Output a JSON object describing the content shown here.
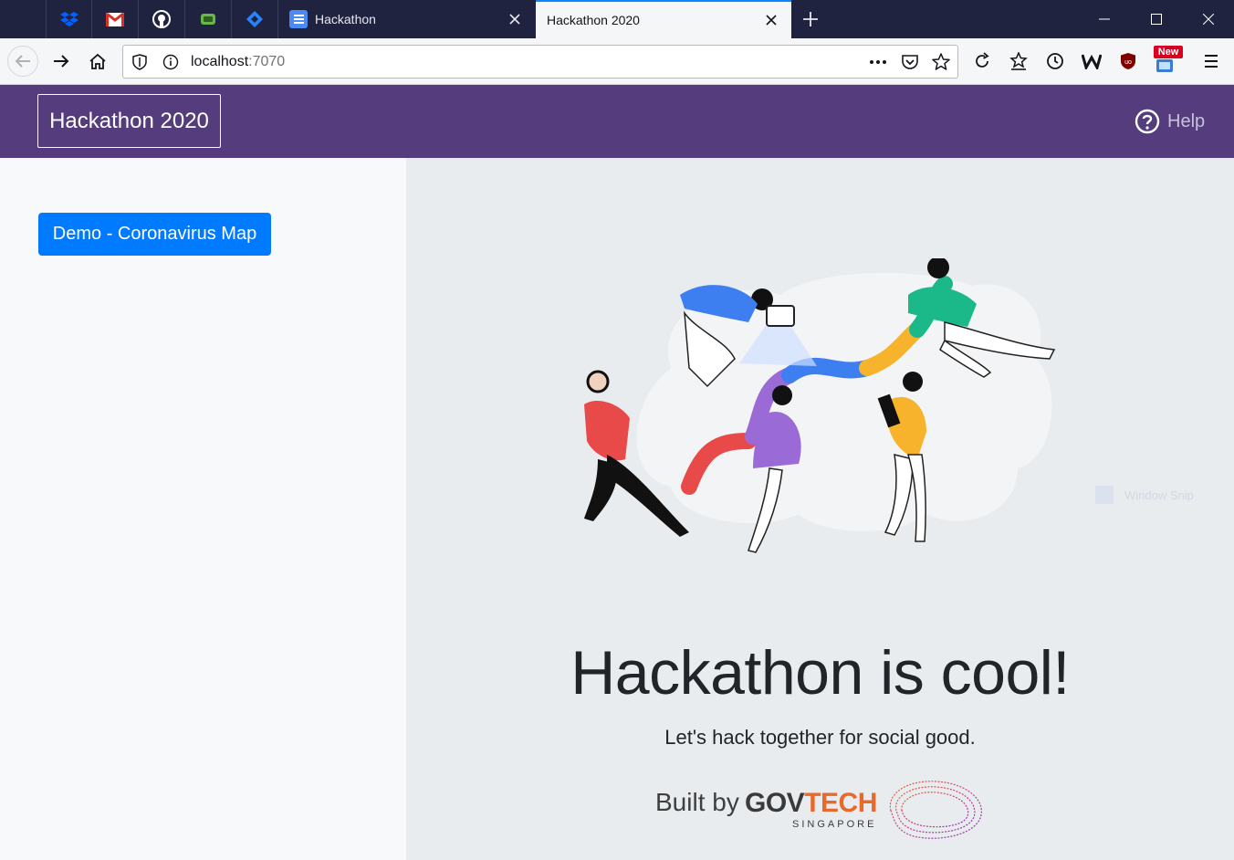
{
  "browser": {
    "pinned_tabs": [
      {
        "icon": "dropbox-icon",
        "color": "#0061fe"
      },
      {
        "icon": "gmail-icon",
        "color": "#d93025"
      },
      {
        "icon": "github-icon",
        "color": "#ffffff"
      },
      {
        "icon": "evernote-icon",
        "color": "#6bb64a"
      },
      {
        "icon": "jira-icon",
        "color": "#2684ff"
      }
    ],
    "tabs": [
      {
        "title": "Hackathon",
        "active": false
      },
      {
        "title": "Hackathon 2020",
        "active": true
      }
    ],
    "url": {
      "host": "localhost",
      "port": ":7070"
    },
    "new_badge": "New"
  },
  "app": {
    "brand": "Hackathon 2020",
    "help_label": "Help",
    "sidebar": {
      "demo_button": "Demo - Coronavirus Map"
    },
    "hero": {
      "headline": "Hackathon is cool!",
      "tagline": "Let's hack together for social good.",
      "built_by": "Built by",
      "logo_gov": "GOV",
      "logo_tech": "TECH",
      "logo_singapore": "SINGAPORE"
    },
    "watermark": "Window Snip",
    "colors": {
      "header": "#553d7d",
      "primary": "#007bff",
      "sidebar_bg": "#f8f9fa",
      "main_bg": "#e9ecef",
      "govtech_orange": "#e8692a"
    }
  }
}
